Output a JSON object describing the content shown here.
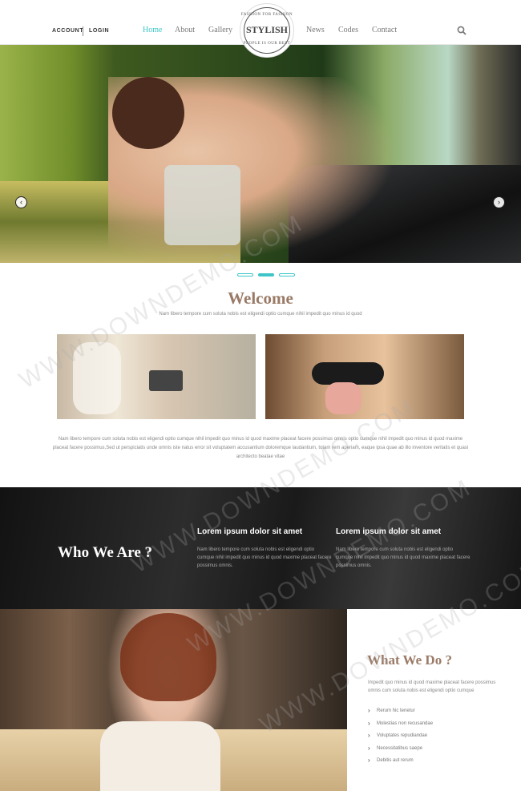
{
  "header": {
    "account_label": "ACCOUNT",
    "login_label": "LOGIN",
    "nav": {
      "home": "Home",
      "about": "About",
      "gallery": "Gallery",
      "news": "News",
      "codes": "Codes",
      "contact": "Contact"
    },
    "logo": {
      "word": "STYLISH",
      "top_text": "FASHION FOR FASHION",
      "bottom_text": "PEOPLE IS OUR BEST"
    },
    "accent_color": "#3fc5c8",
    "search_icon": "search-icon"
  },
  "hero": {
    "slide_count": 3,
    "active_slide": 2
  },
  "welcome": {
    "title": "Welcome",
    "subtitle": "Nam libero tempore cum soluta nobis est eligendi optio cumque nihil impedit quo minus id quod",
    "body": "Nam libero tempore cum soluta nobis est eligendi optio cumque nihil impedit quo minus id quod maxime placeat facere possimus omnis optio cumque nihil impedit quo minus id quod maxime placeat facere possimus,Sed ut perspiciatis unde omnis iste natus error sit voluptatem accusantium doloremque laudantium, totam rem aperiam, eaque ipsa quae ab illo inventore veritatis et quasi architecto beatae vitae"
  },
  "who": {
    "title": "Who We Are ?",
    "col1_title": "Lorem ipsum dolor sit amet",
    "col1_body": "Nam libero tempore cum soluta nobis est eligendi optio cumque nihil impedit quo minus id quod maxime placeat facere possimus omnis.",
    "col2_title": "Lorem ipsum dolor sit amet",
    "col2_body": "Nam libero tempore cum soluta nobis est eligendi optio cumque nihil impedit quo minus id quod maxime placeat facere possimus omnis."
  },
  "what": {
    "title": "What We Do ?",
    "body": "Impedit quo minus id quod maxime placeat facere possimus omnis cum soluta nobis est eligendi optio cumque",
    "items": [
      "Rerum hic tenetur",
      "Molestias non recusandae",
      "Voluptates repudiandae",
      "Necessitatibus saepe",
      "Debitis aut rerum"
    ]
  },
  "watermark": "WWW.DOWNDEMO.COM"
}
